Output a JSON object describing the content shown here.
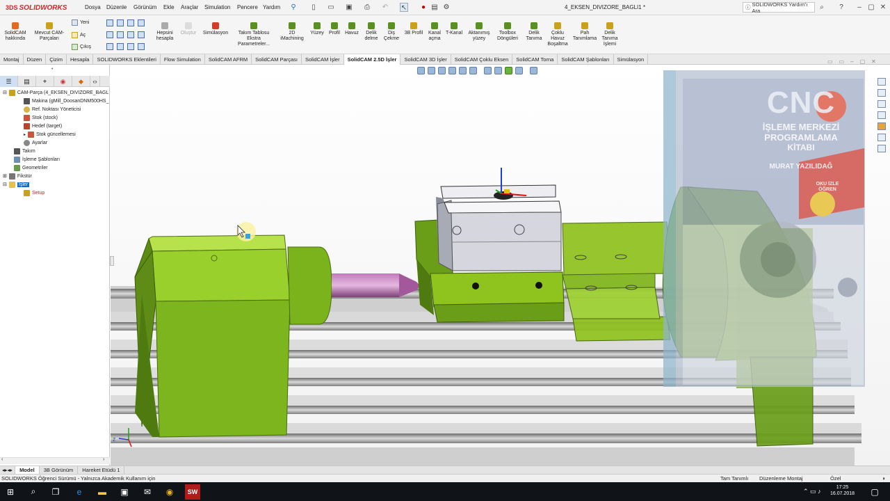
{
  "app": {
    "brand": "SOLIDWORKS",
    "brand_mark": "3DS",
    "document_title": "4_EKSEN_DIVIZORE_BAGLI1 *",
    "help_search_placeholder": "SOLIDWORKS Yardım'ı Ara"
  },
  "menu": [
    "Dosya",
    "Düzenle",
    "Görünüm",
    "Ekle",
    "Araçlar",
    "Simulation",
    "Pencere",
    "Yardım"
  ],
  "commands": {
    "solidcam_about": "SolidCAM hakkında",
    "mevcut": "Mevcut CAM-Parçaları",
    "yeni": "Yeni",
    "ac": "Aç",
    "cikis": "Çıkış",
    "hepsini_hesapla": "Hepsini hesapla",
    "olustur": "Oluştur",
    "simulasyon": "Simülasyon",
    "takim_tablosu": "Takım Tablosu Ekstra Parametreler...",
    "imachining": "2D iMachining",
    "yuzey": "Yüzey",
    "profil": "Profil",
    "havuz": "Havuz",
    "delik_delme": "Delik delme",
    "dis_cekme": "Diş Çekme",
    "profil3b": "3B Profil",
    "kanal_acma": "Kanal açma",
    "t_kanal": "T-Kanal",
    "aktanimis": "Aktanımış yüzey",
    "toolbox": "Toolbox Döngüleri",
    "delik_tanima": "Delik Tanıma",
    "coklu_havuz": "Çoklu Havuz Boşaltma",
    "pah": "Pah Tanımlama",
    "delik_islemi": "Delik Tanıma İşlemi"
  },
  "tabs": [
    "Montaj",
    "Düzen",
    "Çizim",
    "Hesapla",
    "SOLIDWORKS Eklentileri",
    "Flow Simulation",
    "SolidCAM AFRM",
    "SolidCAM Parçası",
    "SolidCAM İşler",
    "SolidCAM 2.5D İşler",
    "SolidCAM 3D İşler",
    "SolidCAM Çoklu Eksen",
    "SolidCAM Torna",
    "SolidCAM Şablonları",
    "Simülasyon"
  ],
  "active_tab_index": 9,
  "tree": [
    {
      "label": "CAM-Parça (4_EKSEN_DIVIZORE_BAGL",
      "indent": 0,
      "icon": "cam-part-icon"
    },
    {
      "label": "Makina (gMill_DoosanDNM500HS_",
      "indent": 1,
      "icon": "machine-icon"
    },
    {
      "label": "Ref. Noktası Yöneticisi",
      "indent": 1,
      "icon": "gear-icon"
    },
    {
      "label": "Stok (stock)",
      "indent": 1,
      "icon": "stock-icon"
    },
    {
      "label": "Hedef (target)",
      "indent": 1,
      "icon": "target-icon"
    },
    {
      "label": "Stok güncellemesi",
      "indent": 2,
      "icon": "update-icon"
    },
    {
      "label": "Ayarlar",
      "indent": 1,
      "icon": "settings-icon"
    },
    {
      "label": "Takım",
      "indent": 0,
      "icon": "tool-icon"
    },
    {
      "label": "İşleme Şablonları",
      "indent": 0,
      "icon": "template-icon"
    },
    {
      "label": "Geometriler",
      "indent": 0,
      "icon": "geometry-icon"
    },
    {
      "label": "Fikstür",
      "indent": 0,
      "icon": "fixture-icon"
    },
    {
      "label": "İşler",
      "indent": 0,
      "icon": "folder-icon",
      "selected": true
    },
    {
      "label": "Setup",
      "indent": 1,
      "icon": "setup-icon"
    }
  ],
  "book": {
    "title_big": "CNC",
    "title_lines": [
      "İŞLEME MERKEZİ",
      "PROGRAMLAMA",
      "KİTABI"
    ],
    "author": "MURAT YAZILIDAĞ",
    "badge": "OKU İZLE ÖĞREN"
  },
  "bottom_tabs": [
    "Model",
    "3B Görünüm",
    "Hareket Etüdü 1"
  ],
  "status": {
    "left": "SOLIDWORKS Öğrenci Sürümü - Yalnızca Akademik Kullanım için",
    "mid1": "Tam Tanımlı",
    "mid2": "Düzenleme Montaj",
    "right": "Özel"
  },
  "clock": {
    "time": "17:25",
    "date": "16.07.2018"
  },
  "colors": {
    "part_green": "#8fc41f",
    "vise_gray": "#dcdde3",
    "brand_red": "#d0262b",
    "selection_blue": "#0b6dc9"
  }
}
